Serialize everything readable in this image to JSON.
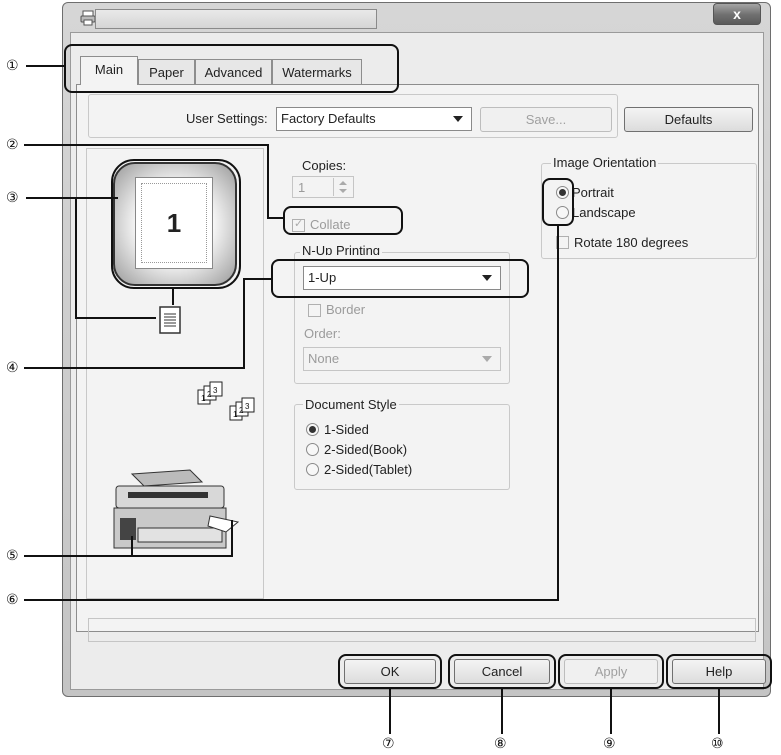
{
  "window": {
    "title": "",
    "close_glyph": "x"
  },
  "tabs": [
    "Main",
    "Paper",
    "Advanced",
    "Watermarks"
  ],
  "user_settings": {
    "label": "User Settings:",
    "value": "Factory Defaults",
    "save_label": "Save...",
    "defaults_label": "Defaults"
  },
  "preview": {
    "page_number": "1"
  },
  "copies": {
    "label": "Copies:",
    "value": "1",
    "collate_label": "Collate"
  },
  "nup": {
    "title": "N-Up Printing",
    "value": "1-Up",
    "border_label": "Border",
    "order_label": "Order:",
    "order_value": "None"
  },
  "document_style": {
    "title": "Document Style",
    "options": [
      "1-Sided",
      "2-Sided(Book)",
      "2-Sided(Tablet)"
    ],
    "selected": "1-Sided"
  },
  "image_orientation": {
    "title": "Image Orientation",
    "options": [
      "Portrait",
      "Landscape"
    ],
    "selected": "Portrait",
    "rotate_label": "Rotate 180 degrees"
  },
  "footer_buttons": {
    "ok": "OK",
    "cancel": "Cancel",
    "apply": "Apply",
    "help": "Help"
  },
  "callouts": {
    "c1": "①",
    "c2": "②",
    "c3": "③",
    "c4": "④",
    "c5": "⑤",
    "c6": "⑥",
    "c7": "⑦",
    "c8": "⑧",
    "c9": "⑨",
    "c10": "⑩"
  },
  "icons": [
    "printer-icon",
    "collate-copies-icon",
    "copier-machine-icon",
    "document-page-icon"
  ]
}
